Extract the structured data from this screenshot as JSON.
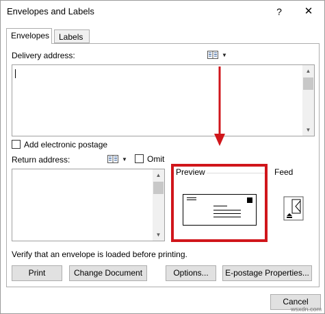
{
  "window": {
    "title": "Envelopes and Labels",
    "help_glyph": "?",
    "close_glyph": "✕"
  },
  "tabs": [
    {
      "label": "Envelopes",
      "active": true
    },
    {
      "label": "Labels",
      "active": false
    }
  ],
  "delivery": {
    "label": "Delivery address:",
    "value": ""
  },
  "postage": {
    "label": "Add electronic postage",
    "checked": false
  },
  "return": {
    "label": "Return address:",
    "value": ""
  },
  "omit": {
    "label": "Omit",
    "checked": false
  },
  "preview": {
    "title": "Preview"
  },
  "feed": {
    "title": "Feed"
  },
  "verify_text": "Verify that an envelope is loaded before printing.",
  "buttons": {
    "print": "Print",
    "change_document": "Change Document",
    "options": "Options...",
    "epostage": "E-postage Properties...",
    "cancel": "Cancel"
  },
  "watermark": "wsxdn.com",
  "colors": {
    "highlight": "#d0161b",
    "arrow": "#d0161b"
  },
  "icons": {
    "address_book": "address-book-icon",
    "dropdown": "dropdown-arrow-icon"
  }
}
